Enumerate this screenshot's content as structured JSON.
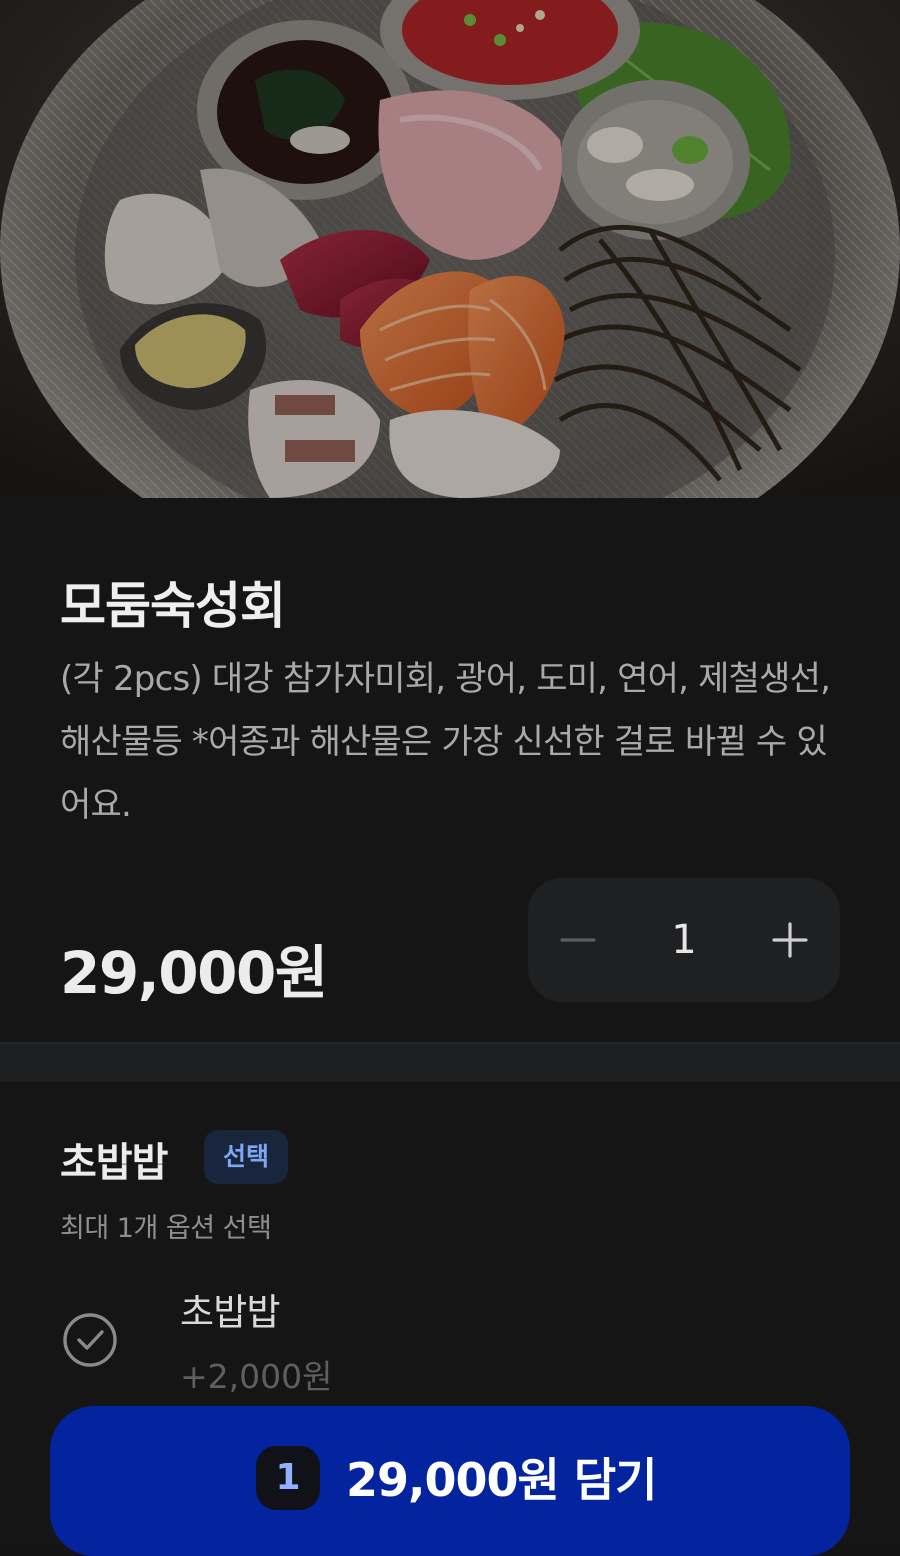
{
  "product": {
    "name": "모둠숙성회",
    "description": "(각 2pcs) 대강 참가자미회, 광어, 도미, 연어, 제철생선, 해산물등 *어종과 해산물은 가장 신선한 걸로 바뀔 수 있어요.",
    "price": "29,000원",
    "quantity": "1"
  },
  "stepper": {
    "decrease_icon": "minus-icon",
    "increase_icon": "plus-icon"
  },
  "option_group": {
    "title": "초밥밥",
    "badge": "선택",
    "subtitle": "최대 1개 옵션 선택",
    "items": [
      {
        "name": "초밥밥",
        "price": "+2,000원",
        "icon": "check-circle-icon"
      }
    ]
  },
  "cart_button": {
    "count": "1",
    "label": "29,000원 담기"
  },
  "colors": {
    "background": "#151516",
    "accent": "#04239e",
    "badge_text": "#7ea7f2"
  }
}
